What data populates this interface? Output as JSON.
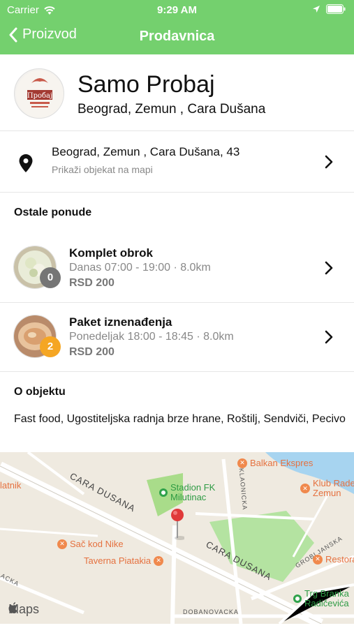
{
  "status": {
    "carrier": "Carrier",
    "time": "9:29 AM"
  },
  "nav": {
    "back_label": "Proizvod",
    "title": "Prodavnica"
  },
  "store": {
    "name": "Samo Probaj",
    "location": "Beograd, Zemun , Cara Dušana",
    "logo_text": "Пробај"
  },
  "address": {
    "line1": "Beograd, Zemun , Cara Dušana, 43",
    "map_link": "Prikaži objekat na mapi"
  },
  "offers_title": "Ostale ponude",
  "offers": [
    {
      "name": "Komplet obrok",
      "time": "Danas 07:00 - 19:00 · 8.0km",
      "price": "RSD 200",
      "count": "0",
      "badge_color": "#757575"
    },
    {
      "name": "Paket iznenađenja",
      "time": "Ponedeljak 18:00 - 18:45 · 8.0km",
      "price": "RSD 200",
      "count": "2",
      "badge_color": "#f5a623"
    }
  ],
  "about": {
    "title": "O objektu",
    "text": "Fast food, Ugostiteljska radnja brze hrane, Roštilj, Sendviči, Pecivo"
  },
  "map": {
    "pois": [
      "Balkan Ekspres",
      "Stadion FK Milutinac",
      "Klub Rade Zemun",
      "Sač kod Nike",
      "Taverna Piatakia",
      "Restora",
      "latnik",
      "Trg Branka Radičevića"
    ],
    "streets": [
      "CARA DUSANA",
      "CARA DUSANA",
      "KLAONICKA",
      "GROBLJANSKA",
      "DOBANOVACKA",
      "ACKA"
    ],
    "attribution": "Maps"
  },
  "colors": {
    "accent": "#74d06e",
    "badge_gray": "#757575",
    "badge_orange": "#f5a623"
  }
}
